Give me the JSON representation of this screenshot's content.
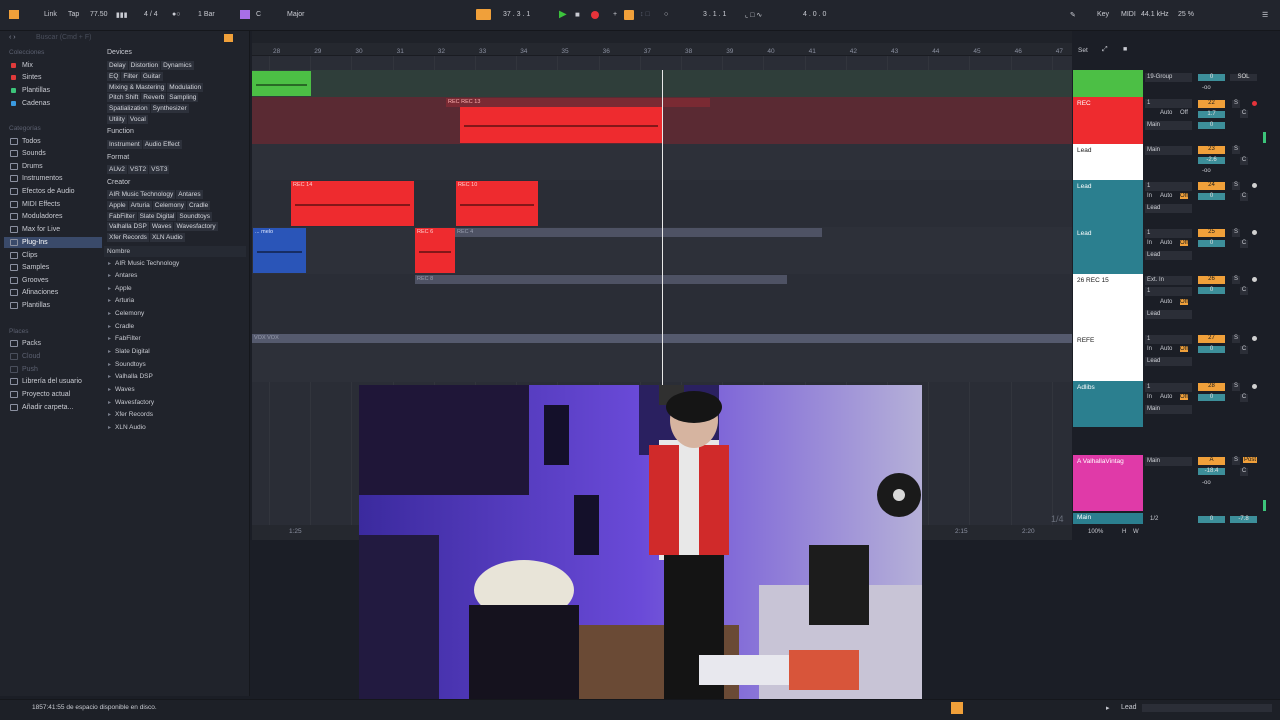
{
  "toolbar": {
    "link": "Link",
    "tap": "Tap",
    "tempo": "77.50",
    "signature": "4 / 4",
    "quantize": "1 Bar",
    "key_root": "C",
    "key_scale": "Major",
    "position": "37 .  3 .  1",
    "loop_start": "3 .  1 .  1",
    "loop_length": "4 .  0 .  0",
    "key_label": "Key",
    "midi_label": "MIDI",
    "sample_rate": "44.1 kHz",
    "cpu": "25 %"
  },
  "browser": {
    "search_placeholder": "Buscar (Cmd + F)",
    "collections_header": "Colecciones",
    "collections": [
      {
        "label": "Mix",
        "color": "#e03a3a"
      },
      {
        "label": "Sintes",
        "color": "#e03a3a"
      },
      {
        "label": "Plantillas",
        "color": "#3cc47a"
      },
      {
        "label": "Cadenas",
        "color": "#3a9ae0"
      }
    ],
    "categories_header": "Categorías",
    "categories": [
      "Todos",
      "Sounds",
      "Drums",
      "Instrumentos",
      "Efectos de Audio",
      "MIDI Effects",
      "Moduladores",
      "Max for Live",
      "Plug-Ins",
      "Clips",
      "Samples",
      "Grooves",
      "Afinaciones",
      "Plantillas"
    ],
    "places_header": "Places",
    "places": [
      "Packs",
      "Cloud",
      "Push",
      "Librería del usuario",
      "Proyecto actual",
      "Añadir carpeta..."
    ],
    "devices_title": "Devices",
    "devices_tags": [
      [
        "Delay",
        "Distortion",
        "Dynamics"
      ],
      [
        "EQ",
        "Filter",
        "Guitar"
      ],
      [
        "Mixing & Mastering",
        "Modulation"
      ],
      [
        "Pitch Shift",
        "Reverb",
        "Sampling"
      ],
      [
        "Spatialization",
        "Synthesizer"
      ],
      [
        "Utility",
        "Vocal"
      ]
    ],
    "function_title": "Function",
    "function_tags": [
      "Instrument",
      "Audio Effect"
    ],
    "format_title": "Format",
    "format_tags": [
      "AUv2",
      "VST2",
      "VST3"
    ],
    "creator_title": "Creator",
    "creator_tags": [
      [
        "AIR Music Technology",
        "Antares"
      ],
      [
        "Apple",
        "Arturia",
        "Celemony",
        "Cradle"
      ],
      [
        "FabFilter",
        "Slate Digital",
        "Soundtoys"
      ],
      [
        "Valhalla DSP",
        "Waves",
        "Wavesfactory"
      ],
      [
        "Xfer Records",
        "XLN Audio"
      ]
    ],
    "name_header": "Nombre",
    "names": [
      "AIR Music Technology",
      "Antares",
      "Apple",
      "Arturia",
      "Celemony",
      "Cradle",
      "FabFilter",
      "Slate Digital",
      "Soundtoys",
      "Valhalla DSP",
      "Waves",
      "Wavesfactory",
      "Xfer Records",
      "XLN Audio"
    ]
  },
  "ruler": {
    "bars": [
      "28",
      "29",
      "30",
      "31",
      "32",
      "33",
      "34",
      "35",
      "36",
      "37",
      "38",
      "39",
      "40",
      "41",
      "42",
      "43",
      "44",
      "45",
      "46",
      "47"
    ],
    "time_left": "1:25",
    "time_a": "2:15",
    "time_b": "2:20",
    "zoom_label": "1/4"
  },
  "clips": {
    "rec13": "REC REC 13",
    "rec14": "REC 14",
    "rec10": "REC 10",
    "melo": "... melo",
    "rec6": "REC 6",
    "rec4": "REC 4",
    "rec8": "REC 8",
    "vox": "VOX VOX"
  },
  "tracks": [
    {
      "name": "",
      "io": "19-Group",
      "num": "",
      "color": "#4cbf45"
    },
    {
      "name": "REC",
      "io": "1",
      "num": "22",
      "color": "#ee2b2f"
    },
    {
      "name": "Lead",
      "io": "Main",
      "num": "23",
      "color": "#ffffff"
    },
    {
      "name": "Lead",
      "io": "1",
      "num": "24",
      "color": "#2b7f8f"
    },
    {
      "name": "Lead",
      "io": "1",
      "num": "25",
      "color": "#2b7f8f"
    },
    {
      "name": "26 REC 15",
      "io": "Ext. In",
      "num": "26",
      "color": "#ffffff"
    },
    {
      "name": "REFE",
      "io": "1",
      "num": "27",
      "color": "#ffffff"
    },
    {
      "name": "Adlibs",
      "io": "1",
      "num": "28",
      "color": "#2b7f8f"
    }
  ],
  "mixer": {
    "set_label": "Set",
    "auto": "Auto",
    "off": "Off",
    "in": "In",
    "main": "Main",
    "lead": "Lead",
    "s": "S",
    "c": "C",
    "sol": "SOL",
    "inf": "-oo",
    "vol_22": "1.7",
    "vol_23": "-2.6",
    "val_0": "0",
    "return_name": "A ValhallaVintag",
    "return_letter": "A",
    "post": "Post",
    "return_vol": "-18.4",
    "master_name": "Main",
    "master_io": "1/2",
    "master_vol": "-7.8",
    "master_zoom": "100%",
    "h": "H",
    "w": "W"
  },
  "status": {
    "disk": "1857:41:55 de espacio disponible en disco.",
    "track": "Lead"
  }
}
